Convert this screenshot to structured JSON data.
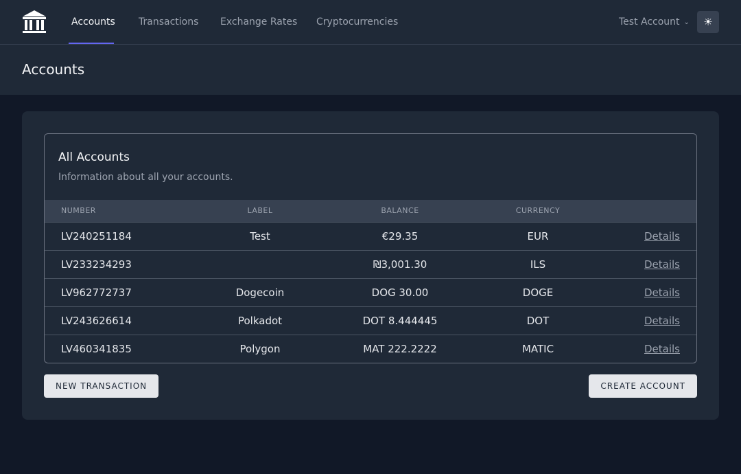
{
  "nav": {
    "logo_icon": "bank-icon",
    "links": [
      {
        "label": "Accounts",
        "active": true
      },
      {
        "label": "Transactions",
        "active": false
      },
      {
        "label": "Exchange Rates",
        "active": false
      },
      {
        "label": "Cryptocurrencies",
        "active": false
      }
    ],
    "account_label": "Test Account",
    "account_chevron": "⌄",
    "theme_icon": "☀",
    "accent_color": "#6366f1"
  },
  "page": {
    "title": "Accounts"
  },
  "card": {
    "title": "All Accounts",
    "subtitle": "Information about all your accounts."
  },
  "table": {
    "headers": {
      "number": "NUMBER",
      "label": "LABEL",
      "balance": "BALANCE",
      "currency": "CURRENCY"
    },
    "rows": [
      {
        "number": "LV240251184",
        "label": "Test",
        "balance": "€29.35",
        "currency": "EUR",
        "action": "Details"
      },
      {
        "number": "LV233234293",
        "label": "",
        "balance": "₪3,001.30",
        "currency": "ILS",
        "action": "Details"
      },
      {
        "number": "LV962772737",
        "label": "Dogecoin",
        "balance": "DOG 30.00",
        "currency": "DOGE",
        "action": "Details"
      },
      {
        "number": "LV243626614",
        "label": "Polkadot",
        "balance": "DOT 8.444445",
        "currency": "DOT",
        "action": "Details"
      },
      {
        "number": "LV460341835",
        "label": "Polygon",
        "balance": "MAT 222.2222",
        "currency": "MATIC",
        "action": "Details"
      }
    ]
  },
  "actions": {
    "new_transaction": "NEW TRANSACTION",
    "create_account": "CREATE ACCOUNT"
  }
}
